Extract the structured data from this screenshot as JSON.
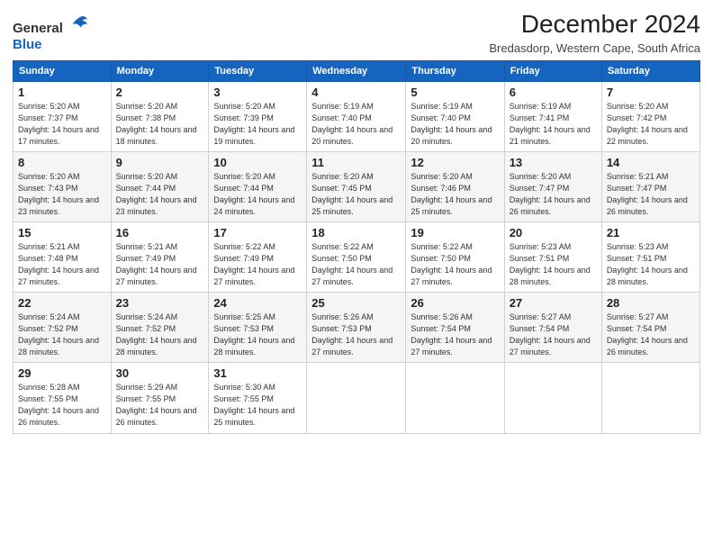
{
  "logo": {
    "general": "General",
    "blue": "Blue"
  },
  "title": "December 2024",
  "location": "Bredasdorp, Western Cape, South Africa",
  "headers": [
    "Sunday",
    "Monday",
    "Tuesday",
    "Wednesday",
    "Thursday",
    "Friday",
    "Saturday"
  ],
  "weeks": [
    [
      {
        "day": "1",
        "sunrise": "5:20 AM",
        "sunset": "7:37 PM",
        "daylight": "14 hours and 17 minutes."
      },
      {
        "day": "2",
        "sunrise": "5:20 AM",
        "sunset": "7:38 PM",
        "daylight": "14 hours and 18 minutes."
      },
      {
        "day": "3",
        "sunrise": "5:20 AM",
        "sunset": "7:39 PM",
        "daylight": "14 hours and 19 minutes."
      },
      {
        "day": "4",
        "sunrise": "5:19 AM",
        "sunset": "7:40 PM",
        "daylight": "14 hours and 20 minutes."
      },
      {
        "day": "5",
        "sunrise": "5:19 AM",
        "sunset": "7:40 PM",
        "daylight": "14 hours and 20 minutes."
      },
      {
        "day": "6",
        "sunrise": "5:19 AM",
        "sunset": "7:41 PM",
        "daylight": "14 hours and 21 minutes."
      },
      {
        "day": "7",
        "sunrise": "5:20 AM",
        "sunset": "7:42 PM",
        "daylight": "14 hours and 22 minutes."
      }
    ],
    [
      {
        "day": "8",
        "sunrise": "5:20 AM",
        "sunset": "7:43 PM",
        "daylight": "14 hours and 23 minutes."
      },
      {
        "day": "9",
        "sunrise": "5:20 AM",
        "sunset": "7:44 PM",
        "daylight": "14 hours and 23 minutes."
      },
      {
        "day": "10",
        "sunrise": "5:20 AM",
        "sunset": "7:44 PM",
        "daylight": "14 hours and 24 minutes."
      },
      {
        "day": "11",
        "sunrise": "5:20 AM",
        "sunset": "7:45 PM",
        "daylight": "14 hours and 25 minutes."
      },
      {
        "day": "12",
        "sunrise": "5:20 AM",
        "sunset": "7:46 PM",
        "daylight": "14 hours and 25 minutes."
      },
      {
        "day": "13",
        "sunrise": "5:20 AM",
        "sunset": "7:47 PM",
        "daylight": "14 hours and 26 minutes."
      },
      {
        "day": "14",
        "sunrise": "5:21 AM",
        "sunset": "7:47 PM",
        "daylight": "14 hours and 26 minutes."
      }
    ],
    [
      {
        "day": "15",
        "sunrise": "5:21 AM",
        "sunset": "7:48 PM",
        "daylight": "14 hours and 27 minutes."
      },
      {
        "day": "16",
        "sunrise": "5:21 AM",
        "sunset": "7:49 PM",
        "daylight": "14 hours and 27 minutes."
      },
      {
        "day": "17",
        "sunrise": "5:22 AM",
        "sunset": "7:49 PM",
        "daylight": "14 hours and 27 minutes."
      },
      {
        "day": "18",
        "sunrise": "5:22 AM",
        "sunset": "7:50 PM",
        "daylight": "14 hours and 27 minutes."
      },
      {
        "day": "19",
        "sunrise": "5:22 AM",
        "sunset": "7:50 PM",
        "daylight": "14 hours and 27 minutes."
      },
      {
        "day": "20",
        "sunrise": "5:23 AM",
        "sunset": "7:51 PM",
        "daylight": "14 hours and 28 minutes."
      },
      {
        "day": "21",
        "sunrise": "5:23 AM",
        "sunset": "7:51 PM",
        "daylight": "14 hours and 28 minutes."
      }
    ],
    [
      {
        "day": "22",
        "sunrise": "5:24 AM",
        "sunset": "7:52 PM",
        "daylight": "14 hours and 28 minutes."
      },
      {
        "day": "23",
        "sunrise": "5:24 AM",
        "sunset": "7:52 PM",
        "daylight": "14 hours and 28 minutes."
      },
      {
        "day": "24",
        "sunrise": "5:25 AM",
        "sunset": "7:53 PM",
        "daylight": "14 hours and 28 minutes."
      },
      {
        "day": "25",
        "sunrise": "5:26 AM",
        "sunset": "7:53 PM",
        "daylight": "14 hours and 27 minutes."
      },
      {
        "day": "26",
        "sunrise": "5:26 AM",
        "sunset": "7:54 PM",
        "daylight": "14 hours and 27 minutes."
      },
      {
        "day": "27",
        "sunrise": "5:27 AM",
        "sunset": "7:54 PM",
        "daylight": "14 hours and 27 minutes."
      },
      {
        "day": "28",
        "sunrise": "5:27 AM",
        "sunset": "7:54 PM",
        "daylight": "14 hours and 26 minutes."
      }
    ],
    [
      {
        "day": "29",
        "sunrise": "5:28 AM",
        "sunset": "7:55 PM",
        "daylight": "14 hours and 26 minutes."
      },
      {
        "day": "30",
        "sunrise": "5:29 AM",
        "sunset": "7:55 PM",
        "daylight": "14 hours and 26 minutes."
      },
      {
        "day": "31",
        "sunrise": "5:30 AM",
        "sunset": "7:55 PM",
        "daylight": "14 hours and 25 minutes."
      },
      null,
      null,
      null,
      null
    ]
  ]
}
